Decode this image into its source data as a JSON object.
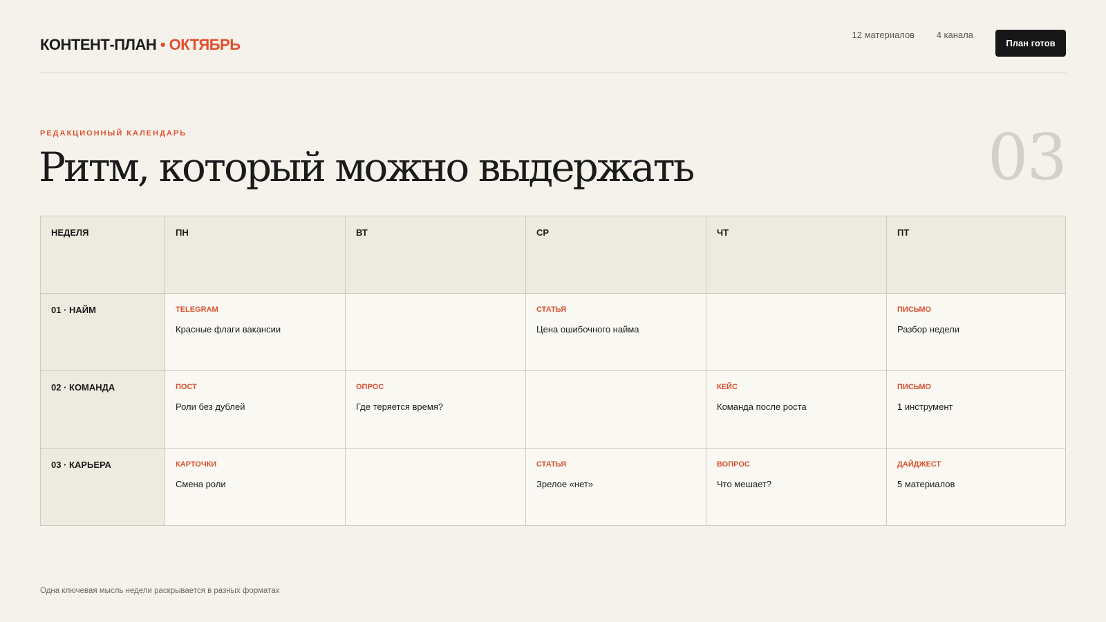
{
  "header": {
    "brand_main": "КОНТЕНТ-ПЛАН",
    "brand_separator": "•",
    "brand_month": "ОКТЯБРЬ",
    "stat_materials": "12 материалов",
    "stat_channels": "4 канала",
    "ready_button": "План готов"
  },
  "hero": {
    "eyebrow": "РЕДАКЦИОННЫЙ КАЛЕНДАРЬ",
    "title": "Ритм, который можно выдержать",
    "number": "03"
  },
  "calendar": {
    "columns": [
      "НЕДЕЛЯ",
      "ПН",
      "ВТ",
      "СР",
      "ЧТ",
      "ПТ"
    ],
    "rows": [
      {
        "week": "01 · НАЙМ",
        "cells": [
          {
            "format": "TELEGRAM",
            "topic": "Красные флаги вакансии"
          },
          {
            "format": "",
            "topic": ""
          },
          {
            "format": "СТАТЬЯ",
            "topic": "Цена ошибочного найма"
          },
          {
            "format": "",
            "topic": ""
          },
          {
            "format": "ПИСЬМО",
            "topic": "Разбор недели"
          }
        ]
      },
      {
        "week": "02 · КОМАНДА",
        "cells": [
          {
            "format": "ПОСТ",
            "topic": "Роли без дублей"
          },
          {
            "format": "ОПРОС",
            "topic": "Где теряется время?"
          },
          {
            "format": "",
            "topic": ""
          },
          {
            "format": "КЕЙС",
            "topic": "Команда после роста"
          },
          {
            "format": "ПИСЬМО",
            "topic": "1 инструмент"
          }
        ]
      },
      {
        "week": "03 · КАРЬЕРА",
        "cells": [
          {
            "format": "КАРТОЧКИ",
            "topic": "Смена роли"
          },
          {
            "format": "",
            "topic": ""
          },
          {
            "format": "СТАТЬЯ",
            "topic": "Зрелое «нет»"
          },
          {
            "format": "ВОПРОС",
            "topic": "Что мешает?"
          },
          {
            "format": "ДАЙДЖЕСТ",
            "topic": "5 материалов"
          }
        ]
      }
    ]
  },
  "footer": {
    "note": "Одна ключевая мысль недели раскрывается в разных форматах"
  },
  "colors": {
    "accent": "#e0502e",
    "background": "#f4f2eb",
    "header_cell": "#edeadf",
    "button": "#171717"
  }
}
